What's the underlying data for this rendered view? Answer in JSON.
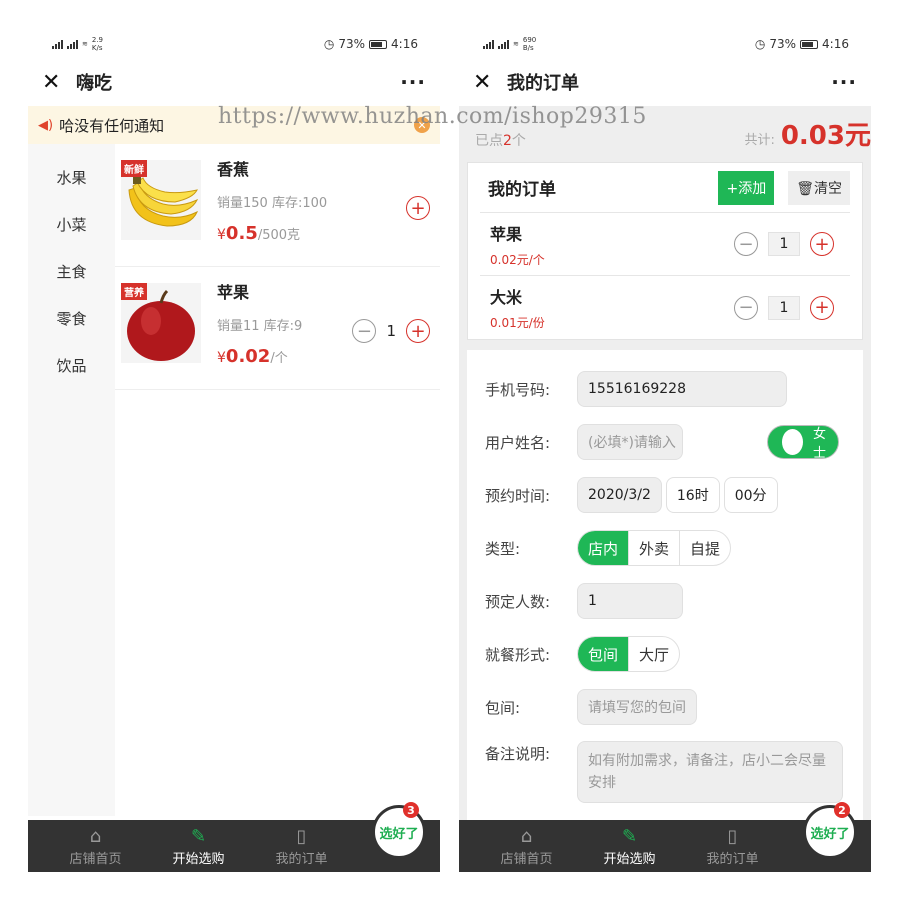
{
  "left": {
    "status": {
      "speed": "2.9",
      "speed_unit": "K/s",
      "battery": "73%",
      "time": "4:16"
    },
    "title": "嗨吃",
    "more": "···",
    "notice": "哈没有任何通知",
    "categories": [
      "水果",
      "小菜",
      "主食",
      "零食",
      "饮品"
    ],
    "goods": [
      {
        "tag": "新鲜",
        "name": "香蕉",
        "stat": "销量150  库存:100",
        "currency": "¥",
        "price": "0.5",
        "unit": "/500克"
      },
      {
        "tag": "营养",
        "name": "苹果",
        "stat": "销量11  库存:9",
        "currency": "¥",
        "price": "0.02",
        "unit": "/个",
        "qty": "1"
      }
    ],
    "tabs": [
      "店铺首页",
      "开始选购",
      "我的订单"
    ],
    "cart_label": "选好了",
    "cart_badge": "3"
  },
  "right": {
    "status": {
      "speed": "690",
      "speed_unit": "B/s",
      "battery": "73%",
      "time": "4:16"
    },
    "title": "我的订单",
    "more": "···",
    "done_prefix": "已点",
    "done_count": "2",
    "done_suffix": "个",
    "total_label": "共计:",
    "total_value": "0.03元",
    "order_title": "我的订单",
    "add_label": "+添加",
    "clear_label": "清空",
    "items": [
      {
        "name": "苹果",
        "price": "0.02元/个",
        "qty": "1"
      },
      {
        "name": "大米",
        "price": "0.01元/份",
        "qty": "1"
      }
    ],
    "form": {
      "phone_label": "手机号码:",
      "phone_value": "15516169228",
      "name_label": "用户姓名:",
      "name_placeholder": "(必填*)请输入",
      "gender": "女士",
      "time_label": "预约时间:",
      "date": "2020/3/2",
      "hour": "16时",
      "minute": "00分",
      "type_label": "类型:",
      "type_options": [
        "店内",
        "外卖",
        "自提"
      ],
      "people_label": "预定人数:",
      "people_value": "1",
      "dining_label": "就餐形式:",
      "dining_options": [
        "包间",
        "大厅"
      ],
      "room_label": "包间:",
      "room_placeholder": "请填写您的包间",
      "note_label": "备注说明:",
      "note_placeholder": "如有附加需求，请备注，店小二会尽量安排"
    },
    "tabs": [
      "店铺首页",
      "开始选购",
      "我的订单"
    ],
    "cart_label": "选好了",
    "cart_badge": "2"
  },
  "watermark": "https://www.huzhan.com/ishop29315",
  "colors": {
    "accent_green": "#1fb756",
    "price_red": "#d6322b",
    "tabbar": "#333333"
  }
}
